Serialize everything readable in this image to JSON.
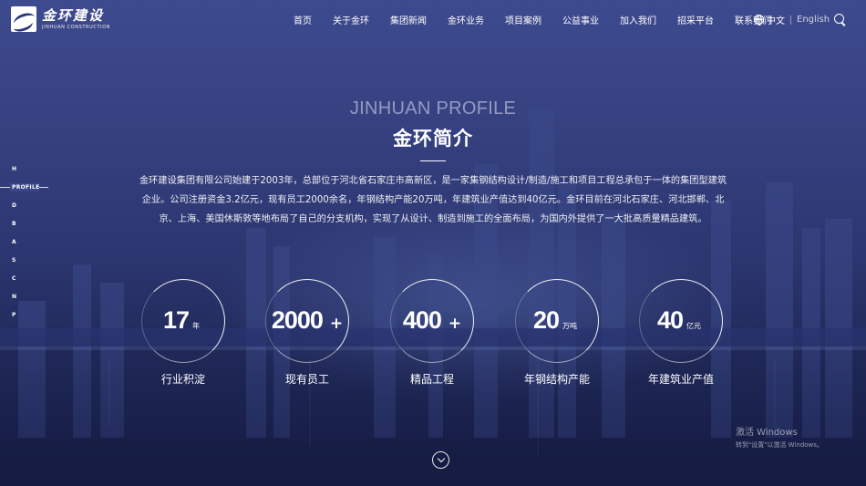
{
  "header": {
    "logo_cn": "金环建设",
    "logo_en": "JINHUAN CONSTRUCTION",
    "nav": [
      "首页",
      "关于金环",
      "集团新闻",
      "金环业务",
      "项目案例",
      "公益事业",
      "加入我们",
      "招采平台",
      "联系我们"
    ],
    "lang_cn": "中文",
    "lang_en": "English"
  },
  "side_nav": [
    "H",
    "PROFILE",
    "D",
    "B",
    "A",
    "S",
    "C",
    "N",
    "P"
  ],
  "profile": {
    "eyebrow": "JINHUAN PROFILE",
    "title": "金环简介",
    "intro": "金环建设集团有限公司始建于2003年，总部位于河北省石家庄市高新区，是一家集钢结构设计/制造/施工和项目工程总承包于一体的集团型建筑企业。公司注册资金3.2亿元，现有员工2000余名，年钢结构产能20万吨，年建筑业产值达到40亿元。金环目前在河北石家庄、河北邯郸、北京、上海、美国休斯敦等地布局了自己的分支机构，实现了从设计、制造到施工的全面布局，为国内外提供了一大批高质量精品建筑。"
  },
  "stats": [
    {
      "num": "17",
      "unit": "年",
      "plus": "",
      "label": "行业积淀"
    },
    {
      "num": "2000",
      "unit": "",
      "plus": "+",
      "label": "现有员工"
    },
    {
      "num": "400",
      "unit": "",
      "plus": "+",
      "label": "精品工程"
    },
    {
      "num": "20",
      "unit": "万吨",
      "plus": "",
      "label": "年钢结构产能"
    },
    {
      "num": "40",
      "unit": "亿元",
      "plus": "",
      "label": "年建筑业产值"
    }
  ],
  "watermark": {
    "line1": "激活 Windows",
    "line2": "转到\"设置\"以激活 Windows。"
  },
  "colors": {
    "background": "#2c3670",
    "text": "#ffffff"
  }
}
